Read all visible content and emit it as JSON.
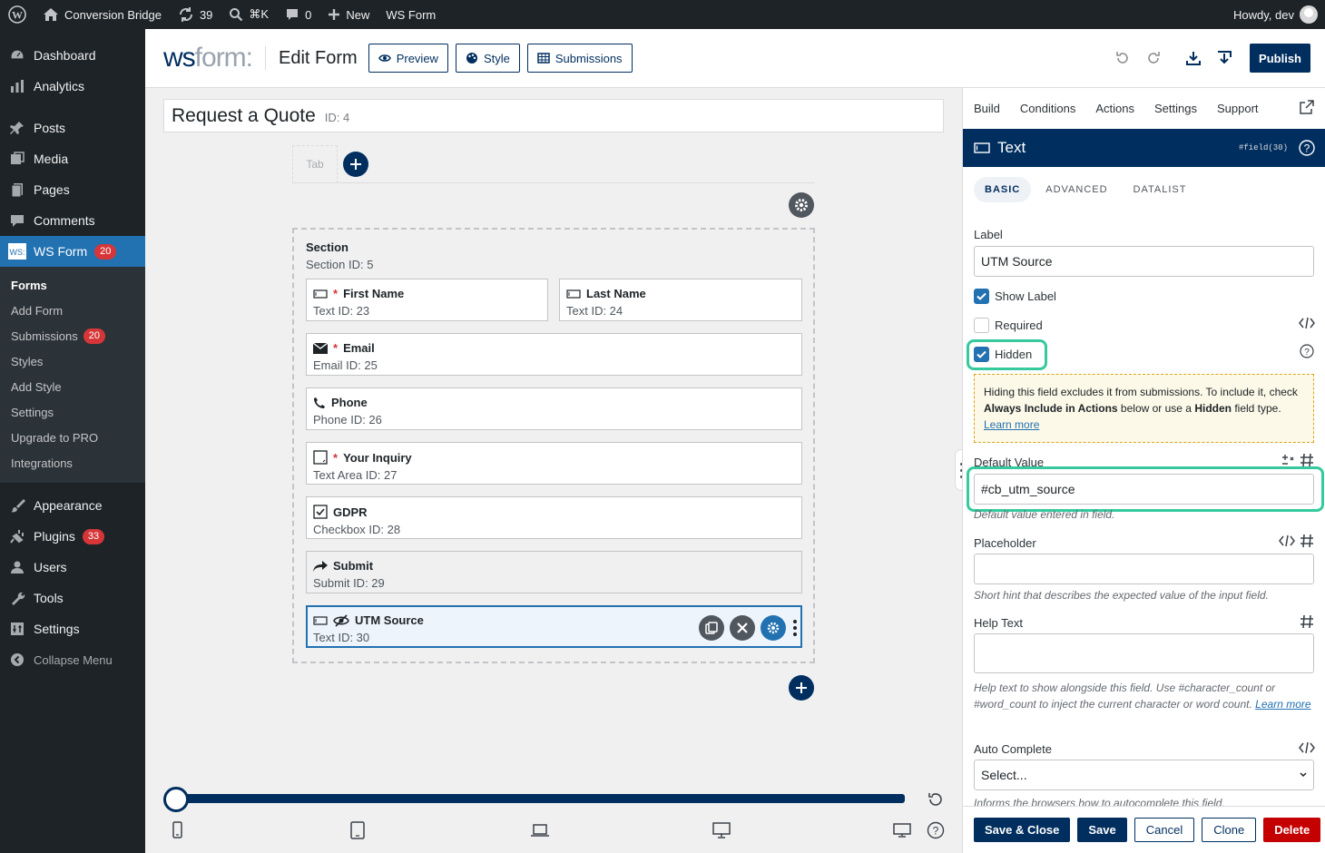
{
  "adminbar": {
    "site_name": "Conversion Bridge",
    "updates_count": "39",
    "search_shortcut": "⌘K",
    "comments_count": "0",
    "new_label": "New",
    "wsform_label": "WS Form",
    "howdy": "Howdy, dev"
  },
  "sidebar": {
    "items_top": [
      {
        "label": "Dashboard",
        "icon": "dashboard-icon"
      },
      {
        "label": "Analytics",
        "icon": "analytics-icon"
      },
      {
        "label": "Posts",
        "icon": "pin-icon"
      },
      {
        "label": "Media",
        "icon": "media-icon"
      },
      {
        "label": "Pages",
        "icon": "pages-icon"
      },
      {
        "label": "Comments",
        "icon": "comment-icon"
      }
    ],
    "wsform": {
      "label": "WS Form",
      "badge": "20"
    },
    "submenu": [
      {
        "label": "Forms"
      },
      {
        "label": "Add Form"
      },
      {
        "label": "Submissions",
        "badge": "20"
      },
      {
        "label": "Styles"
      },
      {
        "label": "Add Style"
      },
      {
        "label": "Settings"
      },
      {
        "label": "Upgrade to PRO"
      },
      {
        "label": "Integrations"
      }
    ],
    "items_bottom": [
      {
        "label": "Appearance",
        "icon": "brush-icon"
      },
      {
        "label": "Plugins",
        "icon": "plugin-icon",
        "badge": "33"
      },
      {
        "label": "Users",
        "icon": "users-icon"
      },
      {
        "label": "Tools",
        "icon": "wrench-icon"
      },
      {
        "label": "Settings",
        "icon": "settings-icon"
      }
    ],
    "collapse_label": "Collapse Menu"
  },
  "header": {
    "logo_ws": "ws",
    "logo_form": "form:",
    "title": "Edit Form",
    "preview_label": "Preview",
    "style_label": "Style",
    "submissions_label": "Submissions",
    "publish_label": "Publish"
  },
  "form": {
    "title": "Request a Quote",
    "id_label": "ID: 4",
    "tab_label": "Tab",
    "section_title": "Section",
    "section_id": "Section  ID: 5",
    "fields": [
      {
        "label": "First Name",
        "sub": "Text  ID: 23",
        "required": "*"
      },
      {
        "label": "Last Name",
        "sub": "Text  ID: 24"
      },
      {
        "label": "Email",
        "sub": "Email  ID: 25",
        "required": "*"
      },
      {
        "label": "Phone",
        "sub": "Phone  ID: 26"
      },
      {
        "label": "Your Inquiry",
        "sub": "Text Area  ID: 27",
        "required": "*"
      },
      {
        "label": "GDPR",
        "sub": "Checkbox  ID: 28"
      },
      {
        "label": "Submit",
        "sub": "Submit  ID: 29"
      },
      {
        "label": "UTM Source",
        "sub": "Text  ID: 30"
      }
    ]
  },
  "panel": {
    "tabs": [
      "Build",
      "Conditions",
      "Actions",
      "Settings",
      "Support"
    ],
    "field_type": "Text",
    "field_var": "#field(30)",
    "subtabs": [
      "BASIC",
      "ADVANCED",
      "DATALIST"
    ],
    "label_label": "Label",
    "label_value": "UTM Source",
    "show_label": "Show Label",
    "required_label": "Required",
    "hidden_label": "Hidden",
    "notice": {
      "part1": "Hiding this field excludes it from submissions. To include it, check ",
      "bold1": "Always Include in Actions",
      "part2": " below or use a ",
      "bold2": "Hidden",
      "part3": " field type. ",
      "link": "Learn more"
    },
    "default_label": "Default Value",
    "default_value": "#cb_utm_source",
    "default_hint": "Default value entered in field.",
    "placeholder_label": "Placeholder",
    "placeholder_hint": "Short hint that describes the expected value of the input field.",
    "help_label": "Help Text",
    "help_hint": "Help text to show alongside this field. Use #character_count or #word_count to inject the current character or word count. ",
    "help_link": "Learn more",
    "autocomplete_label": "Auto Complete",
    "autocomplete_value": "Select...",
    "autocomplete_hint": "Informs the browsers how to autocomplete this field.",
    "footer": {
      "save_close": "Save & Close",
      "save": "Save",
      "cancel": "Cancel",
      "clone": "Clone",
      "delete": "Delete"
    }
  },
  "colors": {
    "primary": "#002e5f",
    "wp_blue": "#2271b1",
    "highlight": "#37c99e",
    "delete": "#c40000"
  }
}
